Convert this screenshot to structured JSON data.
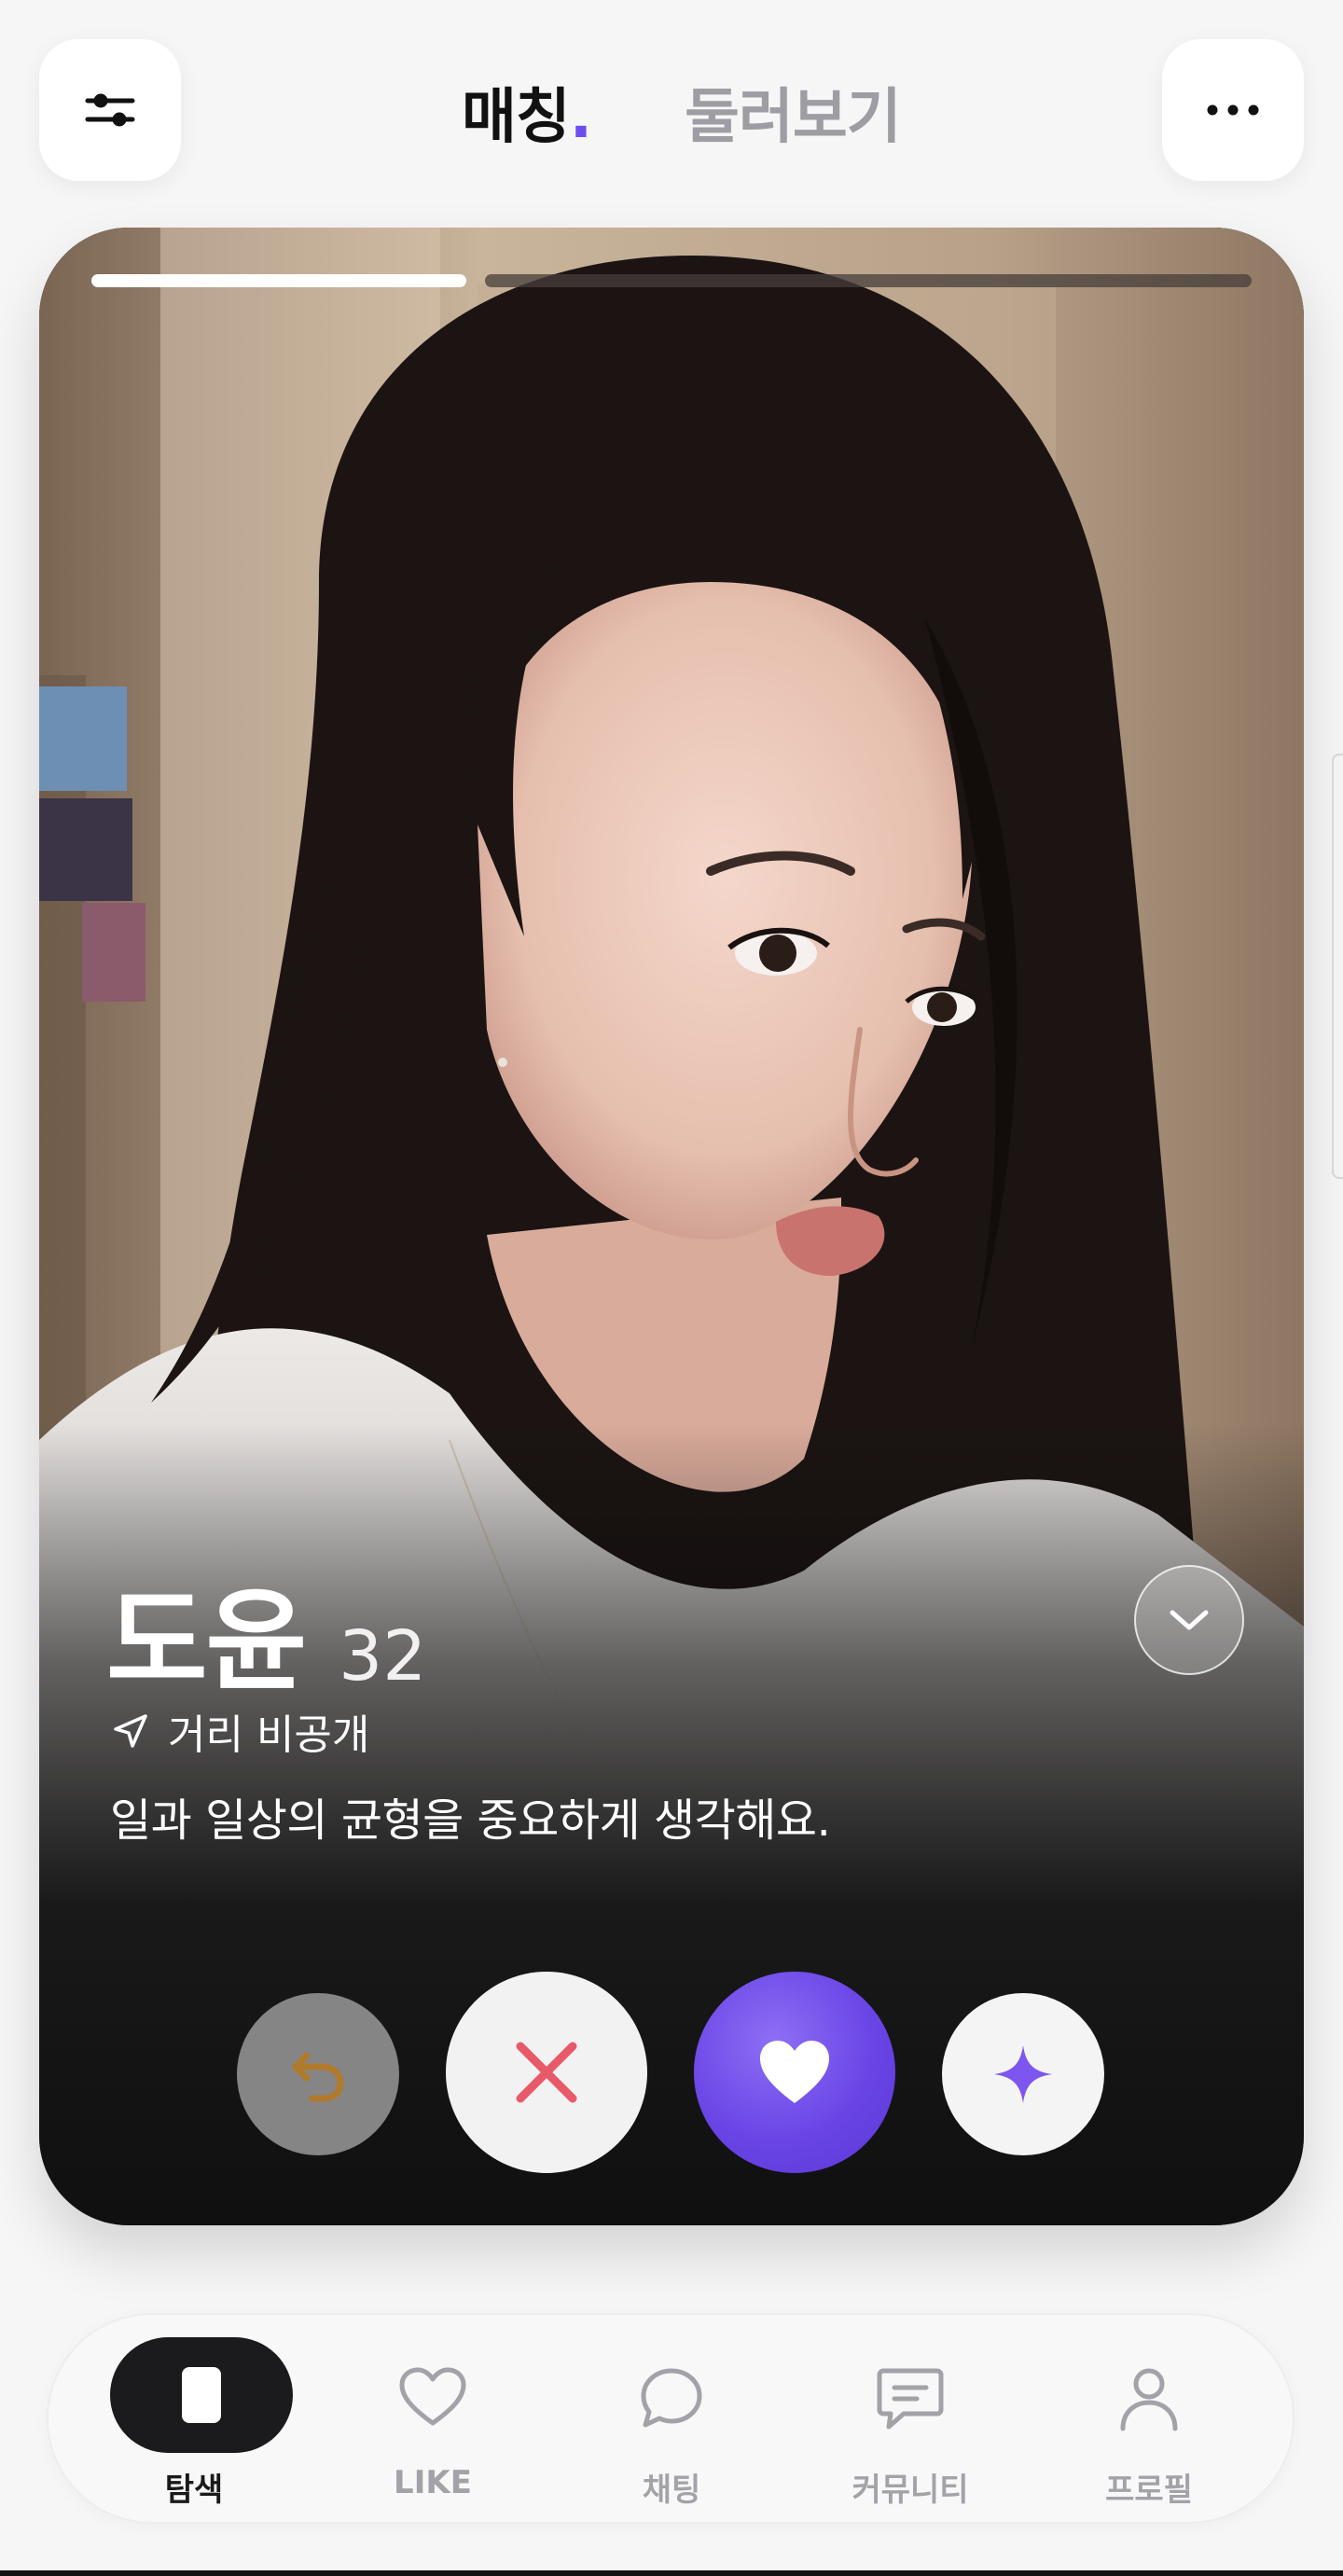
{
  "header": {
    "tabs": [
      {
        "label": "매칭",
        "dot": ".",
        "active": true
      },
      {
        "label": "둘러보기",
        "active": false
      }
    ],
    "filter_icon": "sliders-icon",
    "more_icon": "more-horizontal-icon"
  },
  "card": {
    "photo_count": 2,
    "current_photo": 1,
    "name": "도윤",
    "age": "32",
    "location": "거리 비공개",
    "bio": "일과 일상의 균형을 중요하게 생각해요.",
    "expand_icon": "chevron-down-icon"
  },
  "actions": [
    {
      "name": "undo",
      "icon": "undo-icon"
    },
    {
      "name": "nope",
      "icon": "close-icon"
    },
    {
      "name": "like",
      "icon": "heart-icon"
    },
    {
      "name": "super-like",
      "icon": "sparkle-icon"
    }
  ],
  "nav": {
    "items": [
      {
        "label": "탐색",
        "icon": "explore-card-icon",
        "active": true
      },
      {
        "label": "LIKE",
        "icon": "heart-outline-icon",
        "active": false
      },
      {
        "label": "채팅",
        "icon": "chat-bubble-icon",
        "active": false
      },
      {
        "label": "커뮤니티",
        "icon": "community-message-icon",
        "active": false
      },
      {
        "label": "프로필",
        "icon": "person-icon",
        "active": false
      }
    ]
  },
  "colors": {
    "accent": "#6d4df0",
    "nope": "#e85a6a",
    "undo": "#b07a2c",
    "nav_active": "#1b1b1d",
    "nav_inactive": "#a2a2a8"
  }
}
